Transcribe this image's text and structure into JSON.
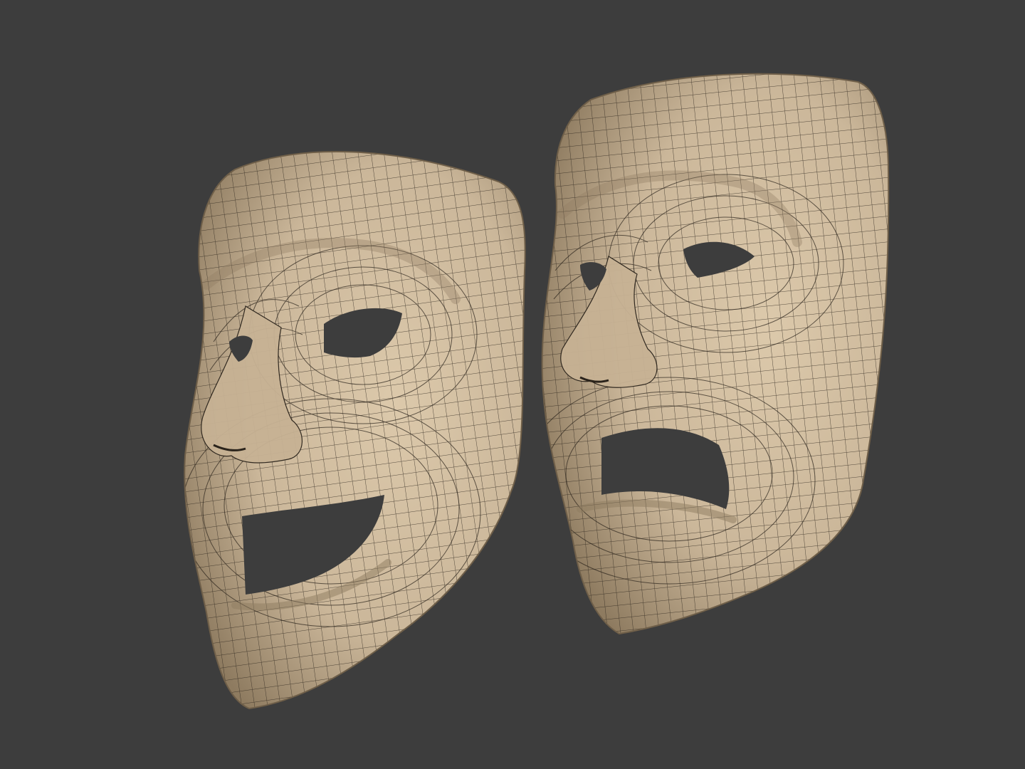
{
  "scene": {
    "background": "#3d3d3d",
    "mesh_base": "#cbb79a",
    "mesh_light": "#dcc9ab",
    "mesh_shadow": "#8e7b60",
    "wire_color": "#2a231b",
    "hole_color": "#3d3d3d"
  },
  "masks": [
    {
      "name": "comedy-mask",
      "expression": "smiling"
    },
    {
      "name": "tragedy-mask",
      "expression": "frowning"
    }
  ]
}
